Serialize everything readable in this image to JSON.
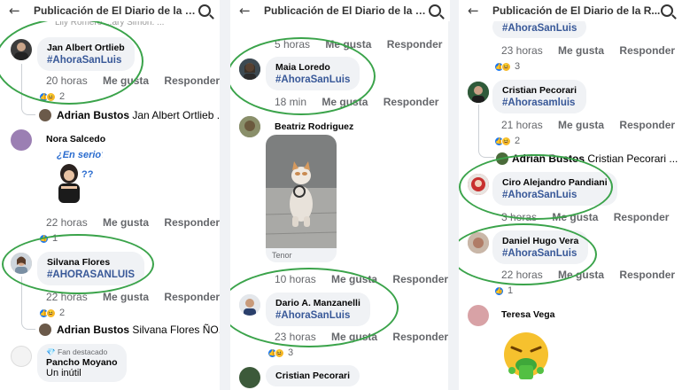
{
  "header_title": "Publicación de El Diario de la R...",
  "actions": {
    "like": "Me gusta",
    "reply": "Responder"
  },
  "panel1": {
    "top_partial": "Lily Romero  ...ary Simon. ...",
    "c1": {
      "name": "Jan Albert Ortlieb",
      "text": "#AhoraSanLuis",
      "time": "20 horas",
      "count": "2"
    },
    "r1": {
      "name": "Adrian Bustos",
      "text": "Jan Albert Ortlieb ..."
    },
    "c2": {
      "name": "Nora Salcedo",
      "sticker": "¿En serio?",
      "time": "22 horas",
      "count": "1"
    },
    "c3": {
      "name": "Silvana Flores",
      "text": "#AHORASANLUIS",
      "time": "22 horas",
      "count": "2"
    },
    "r2": {
      "name": "Adrian Bustos",
      "text": "Silvana Flores ÑO..."
    },
    "c4": {
      "badge": "Fan destacado",
      "name": "Pancho Moyano",
      "text": "Un inútil"
    }
  },
  "panel2": {
    "top": {
      "time": "5 horas"
    },
    "c1": {
      "name": "Maia Loredo",
      "text": "#AhoraSanLuis",
      "time": "18 min"
    },
    "c2": {
      "name": "Beatriz Rodriguez",
      "gif_source": "Tenor",
      "time": "10 horas"
    },
    "c3": {
      "name": "Dario A. Manzanelli",
      "text": "#AhoraSanLuis",
      "time": "23 horas",
      "count": "3"
    },
    "c4": {
      "name": "Cristian Pecorari"
    }
  },
  "panel3": {
    "top": {
      "text": "#AhoraSanLuis",
      "time": "23 horas",
      "count": "3"
    },
    "c1": {
      "name": "Cristian Pecorari",
      "text": "#Ahorasamluis",
      "time": "21 horas",
      "count": "2"
    },
    "r1": {
      "name": "Adrian Bustos",
      "text": "Cristian Pecorari ..."
    },
    "c2": {
      "name": "Ciro Alejandro Pandiani",
      "text": "#AhoraSanLuis",
      "time": "3 horas"
    },
    "c3": {
      "name": "Daniel Hugo Vera",
      "text": "#AhoraSanLuis",
      "time": "22 horas",
      "count": "1"
    },
    "c4": {
      "name": "Teresa Vega"
    }
  },
  "colors": {
    "highlight": "#3aa34a",
    "hashtag": "#385898",
    "like": "#1877f2"
  }
}
